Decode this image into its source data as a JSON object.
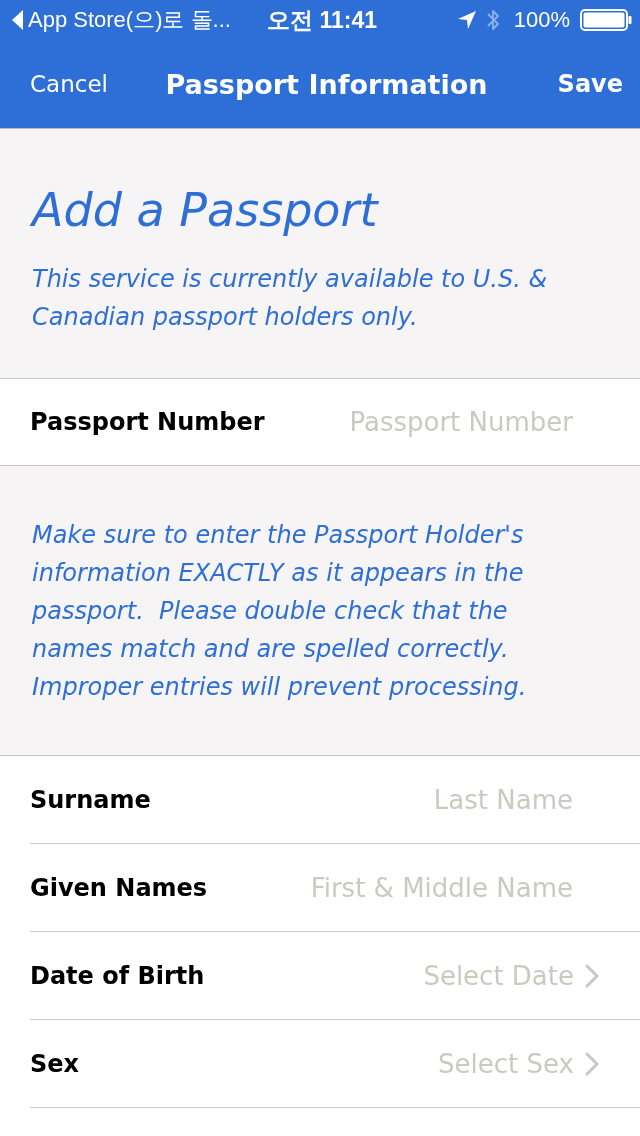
{
  "status_bar": {
    "back_label": "App Store(으)로 돌...",
    "time": "오전 11:41",
    "battery": "100%"
  },
  "nav_bar": {
    "left_button": "Cancel",
    "title": "Passport Information",
    "right_button": "Save"
  },
  "intro": {
    "title": "Add a Passport",
    "subtitle": "This service is currently available to U.S. & Canadian passport holders only."
  },
  "passport_field": {
    "label": "Passport Number",
    "placeholder": "Passport Number"
  },
  "notice": "Make sure to enter the Passport Holder's information EXACTLY as it appears in the passport.  Please double check that the names match and are spelled correctly. Improper entries will prevent processing.",
  "fields": [
    {
      "kind": "text",
      "label": "Surname",
      "placeholder": "Last Name"
    },
    {
      "kind": "text",
      "label": "Given Names",
      "placeholder": "First & Middle Name"
    },
    {
      "kind": "select",
      "label": "Date of Birth",
      "placeholder": "Select Date"
    },
    {
      "kind": "select",
      "label": "Sex",
      "placeholder": "Select Sex"
    }
  ]
}
